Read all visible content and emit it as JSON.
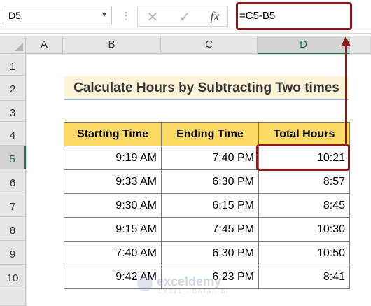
{
  "formula_bar": {
    "name_box": "D5",
    "separator": "⋮",
    "cancel_icon": "✕",
    "enter_icon": "✓",
    "fx_label": "fx",
    "formula": "=C5-B5"
  },
  "columns": [
    "A",
    "B",
    "C",
    "D"
  ],
  "rows": [
    "1",
    "2",
    "3",
    "4",
    "5",
    "6",
    "7",
    "8",
    "9",
    "10"
  ],
  "title": "Calculate Hours by Subtracting Two times",
  "table": {
    "headers": [
      "Starting Time",
      "Ending Time",
      "Total Hours"
    ],
    "rows": [
      [
        "9:19 AM",
        "7:40 PM",
        "10:21"
      ],
      [
        "9:33 AM",
        "6:30 PM",
        "8:57"
      ],
      [
        "9:30 AM",
        "6:15 PM",
        "8:45"
      ],
      [
        "9:15 AM",
        "7:45 PM",
        "10:30"
      ],
      [
        "7:40 AM",
        "6:30 PM",
        "10:50"
      ],
      [
        "9:42 AM",
        "6:23 PM",
        "8:41"
      ]
    ]
  },
  "watermark": {
    "name": "exceldemy",
    "tagline": "EXCEL · DATA · BI"
  },
  "colors": {
    "header_fill": "#ffd966",
    "title_fill": "#fdf3d9",
    "highlight": "#8b1a1a",
    "active_header": "#217346"
  }
}
